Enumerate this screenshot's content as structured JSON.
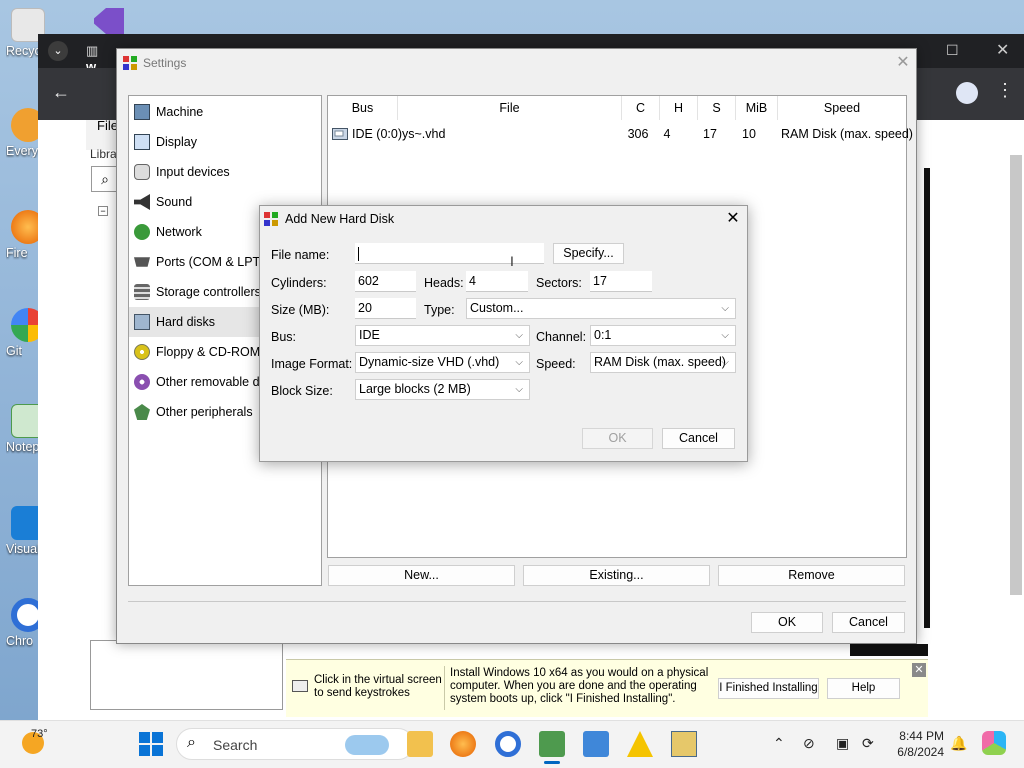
{
  "desktop": {
    "icons": [
      {
        "label": "Recyc",
        "color": "#d9d9d9"
      },
      {
        "label": "Every",
        "color": "#f0a030"
      },
      {
        "label": "Fire",
        "color": "#e66000"
      },
      {
        "label": "Git",
        "color": "#3a78c9"
      },
      {
        "label": "Notep",
        "color": "#4d9a4d"
      },
      {
        "label": "Visual Co",
        "color": "#1a7ed6"
      },
      {
        "label": "Chro",
        "color": "#2f6fd6"
      }
    ]
  },
  "settings": {
    "title": "Settings",
    "categories": [
      {
        "label": "Machine",
        "icon": "machine-icon"
      },
      {
        "label": "Display",
        "icon": "display-icon"
      },
      {
        "label": "Input devices",
        "icon": "input-devices-icon"
      },
      {
        "label": "Sound",
        "icon": "sound-icon"
      },
      {
        "label": "Network",
        "icon": "network-icon"
      },
      {
        "label": "Ports (COM & LPT)",
        "icon": "ports-icon"
      },
      {
        "label": "Storage controllers",
        "icon": "storage-icon"
      },
      {
        "label": "Hard disks",
        "icon": "hard-disk-icon"
      },
      {
        "label": "Floppy & CD-ROM d",
        "icon": "floppy-icon"
      },
      {
        "label": "Other removable de",
        "icon": "removable-icon"
      },
      {
        "label": "Other peripherals",
        "icon": "peripherals-icon"
      }
    ],
    "selected_category": "Hard disks",
    "table": {
      "headers": [
        "Bus",
        "File",
        "C",
        "H",
        "S",
        "MiB",
        "Speed"
      ],
      "rows": [
        {
          "bus": "IDE (0:0)",
          "file": "ys~.vhd",
          "c": "306",
          "h": "4",
          "s": "17",
          "mib": "10",
          "speed": "RAM Disk (max. speed)"
        }
      ]
    },
    "buttons": {
      "new": "New...",
      "existing": "Existing...",
      "remove": "Remove",
      "ok": "OK",
      "cancel": "Cancel"
    }
  },
  "dialog": {
    "title": "Add New Hard Disk",
    "file_name_label": "File name:",
    "file_name_value": "",
    "specify_label": "Specify...",
    "cylinders_label": "Cylinders:",
    "cylinders_value": "602",
    "heads_label": "Heads:",
    "heads_value": "4",
    "sectors_label": "Sectors:",
    "sectors_value": "17",
    "size_label": "Size (MB):",
    "size_value": "20",
    "type_label": "Type:",
    "type_value": "Custom...",
    "bus_label": "Bus:",
    "bus_value": "IDE",
    "channel_label": "Channel:",
    "channel_value": "0:1",
    "image_format_label": "Image Format:",
    "image_format_value": "Dynamic-size VHD (.vhd)",
    "speed_label": "Speed:",
    "speed_value": "RAM Disk (max. speed)",
    "block_size_label": "Block Size:",
    "block_size_value": "Large blocks (2 MB)",
    "ok_label": "OK",
    "cancel_label": "Cancel"
  },
  "helper": {
    "hint": "Click in the virtual screen\nto send keystrokes",
    "message": "Install Windows 10 x64 as you would on a physical computer. When you are done and the operating system boots up, click \"I Finished Installing\".",
    "finished_label": "I Finished Installing",
    "help_label": "Help"
  },
  "browser_partial": {
    "tab_fragment": "w",
    "file_menu": "File",
    "libra_fragment": "Libra"
  },
  "taskbar": {
    "weather": "73°",
    "search_placeholder": "Search",
    "time": "8:44 PM",
    "date": "6/8/2024",
    "accent": "#0067c0"
  }
}
